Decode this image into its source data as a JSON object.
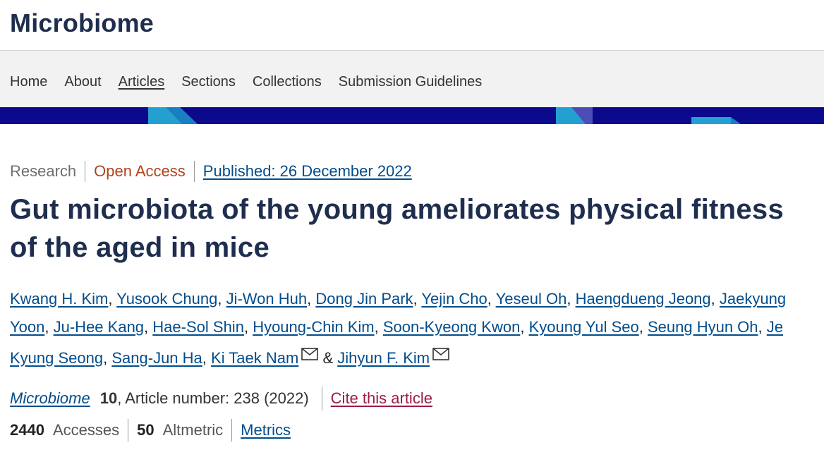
{
  "header": {
    "journal_title": "Microbiome"
  },
  "nav": {
    "items": [
      {
        "label": "Home"
      },
      {
        "label": "About"
      },
      {
        "label": "Articles",
        "active": true
      },
      {
        "label": "Sections"
      },
      {
        "label": "Collections"
      },
      {
        "label": "Submission Guidelines"
      }
    ]
  },
  "banner": {
    "background": "#0b0a8c",
    "accent_colors": [
      "#24a0d0",
      "#4d4db8"
    ]
  },
  "article": {
    "type": "Research",
    "access": "Open Access",
    "published": "Published: 26 December 2022",
    "title": "Gut microbiota of the young ameliorates physical fitness of the aged in mice",
    "authors": [
      "Kwang H. Kim",
      "Yusook Chung",
      "Ji-Won Huh",
      "Dong Jin Park",
      "Yejin Cho",
      "Yeseul Oh",
      "Haengdueng Jeong",
      "Jaekyung Yoon",
      "Ju-Hee Kang",
      "Hae-Sol Shin",
      "Hyoung-Chin Kim",
      "Soon-Kyeong Kwon",
      "Kyoung Yul Seo",
      "Seung Hyun Oh",
      "Je Kyung Seong",
      "Sang-Jun Ha",
      "Ki Taek Nam",
      "Jihyun F. Kim"
    ],
    "separator": ",",
    "conjunction": "&",
    "journal": "Microbiome",
    "volume": "10",
    "article_number_text": ", Article number: 238 (2022)",
    "cite_label": "Cite this article",
    "accesses_count": "2440",
    "accesses_label": "Accesses",
    "altmetric_count": "50",
    "altmetric_label": "Altmetric",
    "metrics_label": "Metrics"
  },
  "colors": {
    "title": "#1f2e4e",
    "link": "#024d8c",
    "open_access": "#b0431c",
    "cite": "#9c1b4a"
  }
}
